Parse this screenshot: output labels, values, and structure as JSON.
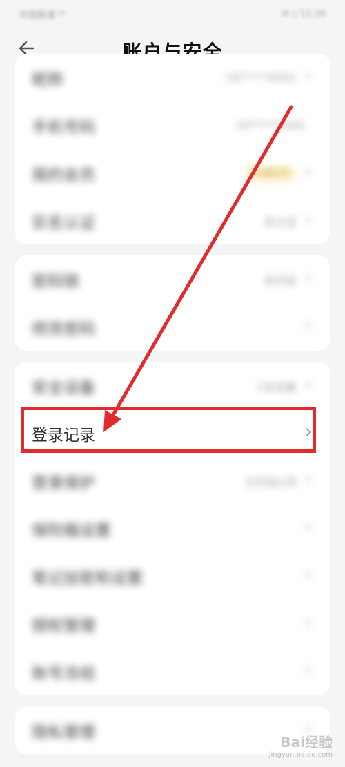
{
  "status_bar": {
    "left": "中国联通 ⁴ᴳ ",
    "right": "✉ ▯ 12:34"
  },
  "header": {
    "title": "账户与安全",
    "back_icon": "arrow-left-icon"
  },
  "groups": [
    {
      "items": [
        {
          "label": "昵称",
          "value": "187****8581",
          "chevron": true
        },
        {
          "label": "手机号码",
          "value": "187****8581",
          "chevron": false
        },
        {
          "label": "我的会员",
          "value": "开通会员",
          "badge": true,
          "chevron": true
        },
        {
          "label": "实名认证",
          "value": "未认证",
          "chevron": true
        }
      ]
    },
    {
      "items": [
        {
          "label": "密码锁",
          "value": "未开启",
          "chevron": true
        },
        {
          "label": "修改密码",
          "value": "",
          "chevron": true
        }
      ]
    },
    {
      "items": [
        {
          "label": "安全设备",
          "value": "1台设备",
          "chevron": true
        },
        {
          "label": "登录记录",
          "value": "",
          "chevron": true,
          "highlighted": true
        },
        {
          "label": "登录保护",
          "value": "已开启1项",
          "chevron": true
        },
        {
          "label": "保险箱设置",
          "value": "",
          "chevron": true
        },
        {
          "label": "笔记加密和设置",
          "value": "",
          "chevron": true
        },
        {
          "label": "授权管理",
          "value": "",
          "chevron": true
        },
        {
          "label": "账号冻结",
          "value": "",
          "chevron": true
        }
      ]
    },
    {
      "items": [
        {
          "label": "隐私管理",
          "value": "",
          "chevron": true
        }
      ]
    }
  ],
  "annotation": {
    "color": "#e02c2c"
  },
  "watermark": {
    "main": "Bai经验",
    "sub": "jingyan.baidu.com"
  }
}
